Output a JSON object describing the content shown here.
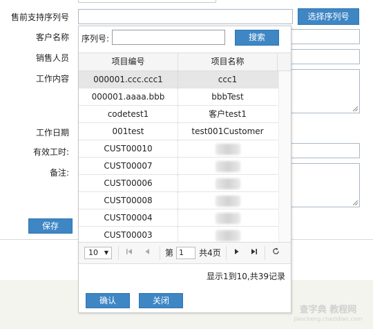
{
  "form": {
    "labels": {
      "serial": "售前支持序列号",
      "customer": "客户名称",
      "sales": "销售人员",
      "content": "工作内容",
      "date": "工作日期",
      "hours": "有效工时:",
      "remark": "备注:"
    },
    "select_serial_button": "选择序列号",
    "save_button": "保存"
  },
  "popup": {
    "search_label": "序列号:",
    "search_value": "",
    "search_button": "搜索",
    "columns": [
      "项目编号",
      "项目名称"
    ],
    "rows": [
      {
        "code": "000001.ccc.ccc1",
        "name": "ccc1",
        "selected": true
      },
      {
        "code": "000001.aaaa.bbb",
        "name": "bbbTest",
        "selected": false
      },
      {
        "code": "codetest1",
        "name": "客户test1",
        "selected": false
      },
      {
        "code": "001test",
        "name": "test001Customer",
        "selected": false
      },
      {
        "code": "CUST00010",
        "name": "",
        "selected": false
      },
      {
        "code": "CUST00007",
        "name": "",
        "selected": false
      },
      {
        "code": "CUST00006",
        "name": "",
        "selected": false
      },
      {
        "code": "CUST00008",
        "name": "",
        "selected": false
      },
      {
        "code": "CUST00004",
        "name": "",
        "selected": false
      },
      {
        "code": "CUST00003",
        "name": "",
        "selected": false
      }
    ],
    "pager": {
      "page_size": "10",
      "page_prefix": "第",
      "current_page": "1",
      "page_suffix": "共4页",
      "summary": "显示1到10,共39记录"
    },
    "confirm_button": "确认",
    "close_button": "关闭"
  },
  "watermark": {
    "line1": "查字典 教程网",
    "line2": "jiaocheng.chazidian.com"
  },
  "colors": {
    "accent": "#3e86c4",
    "selected_row": "#e6e6e6"
  }
}
